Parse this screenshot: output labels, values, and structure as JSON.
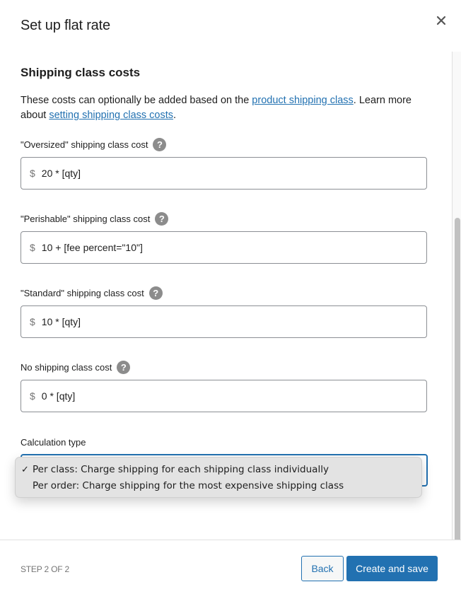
{
  "modal": {
    "title": "Set up flat rate",
    "close_icon": "close-icon"
  },
  "section": {
    "title": "Shipping class costs",
    "description": {
      "text_before_link": "These costs can optionally be added based on the ",
      "link1": "product shipping class",
      "text_middle": ". Learn more about ",
      "link2": "setting shipping class costs",
      "text_after": "."
    }
  },
  "fields": [
    {
      "label": "\"Oversized\" shipping class cost",
      "prefix": "$",
      "value": "20 * [qty]",
      "help_icon": "?"
    },
    {
      "label": "\"Perishable\" shipping class cost",
      "prefix": "$",
      "value": "10 + [fee percent=\"10\"]",
      "help_icon": "?"
    },
    {
      "label": "\"Standard\" shipping class cost",
      "prefix": "$",
      "value": "10 * [qty]",
      "help_icon": "?"
    },
    {
      "label": "No shipping class cost",
      "prefix": "$",
      "value": "0 * [qty]",
      "help_icon": "?"
    }
  ],
  "calculation": {
    "label": "Calculation type",
    "selected": "Per class: Charge shipping for each shipping class individually",
    "options": [
      {
        "label": "Per class: Charge shipping for each shipping class individually",
        "checked": true,
        "check": "✓"
      },
      {
        "label": "Per order: Charge shipping for the most expensive shipping class",
        "checked": false,
        "check": ""
      }
    ]
  },
  "footer": {
    "step": "STEP 2 OF 2",
    "back_label": "Back",
    "save_label": "Create and save"
  },
  "colors": {
    "accent": "#2271b1",
    "help_icon": "#8c8c8c",
    "dropdown_bg": "#e3e3e3"
  }
}
